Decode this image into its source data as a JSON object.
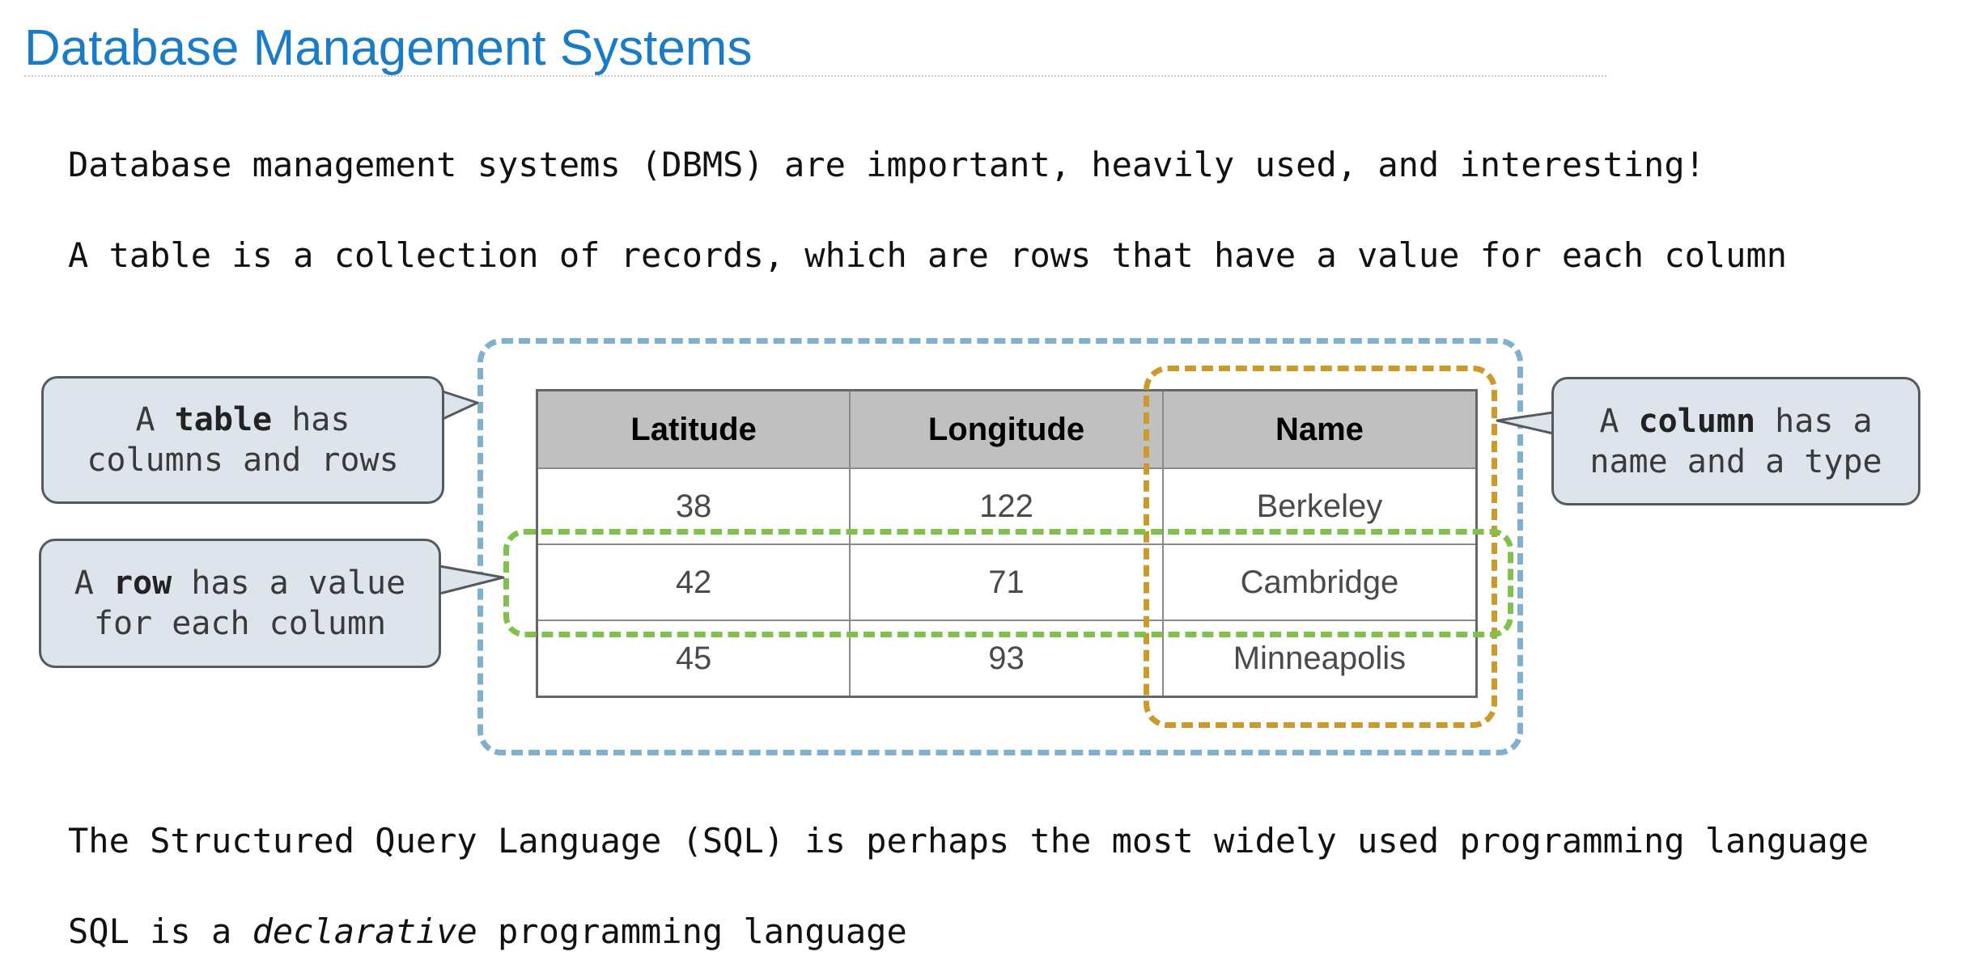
{
  "slide": {
    "title": "Database Management Systems",
    "paragraphs": {
      "p1": "Database management systems (DBMS) are important, heavily used, and interesting!",
      "p2": "A table is a collection of records, which are rows that have a value for each column",
      "p3": "The Structured Query Language (SQL) is perhaps the most widely used programming language",
      "p4_prefix": "SQL is a ",
      "p4_emphasis": "declarative",
      "p4_suffix": " programming language"
    }
  },
  "table": {
    "headers": [
      "Latitude",
      "Longitude",
      "Name"
    ],
    "rows": [
      [
        "38",
        "122",
        "Berkeley"
      ],
      [
        "42",
        "71",
        "Cambridge"
      ],
      [
        "45",
        "93",
        "Minneapolis"
      ]
    ]
  },
  "callouts": {
    "table": {
      "pre": "A ",
      "bold": "table",
      "post": " has",
      "line2": "columns and rows"
    },
    "row": {
      "pre": "A ",
      "bold": "row",
      "post": " has a value",
      "line2": "for each column"
    },
    "column": {
      "pre": "A ",
      "bold": "column",
      "post": " has a",
      "line2": "name and a type"
    }
  },
  "colors": {
    "title": "#1a7cc6",
    "table_frame": "#7fb0cd",
    "column_frame": "#cb9a2d",
    "row_frame": "#80c04c",
    "callout_fill": "#dde4ec",
    "header_fill": "#c0c0c0"
  }
}
